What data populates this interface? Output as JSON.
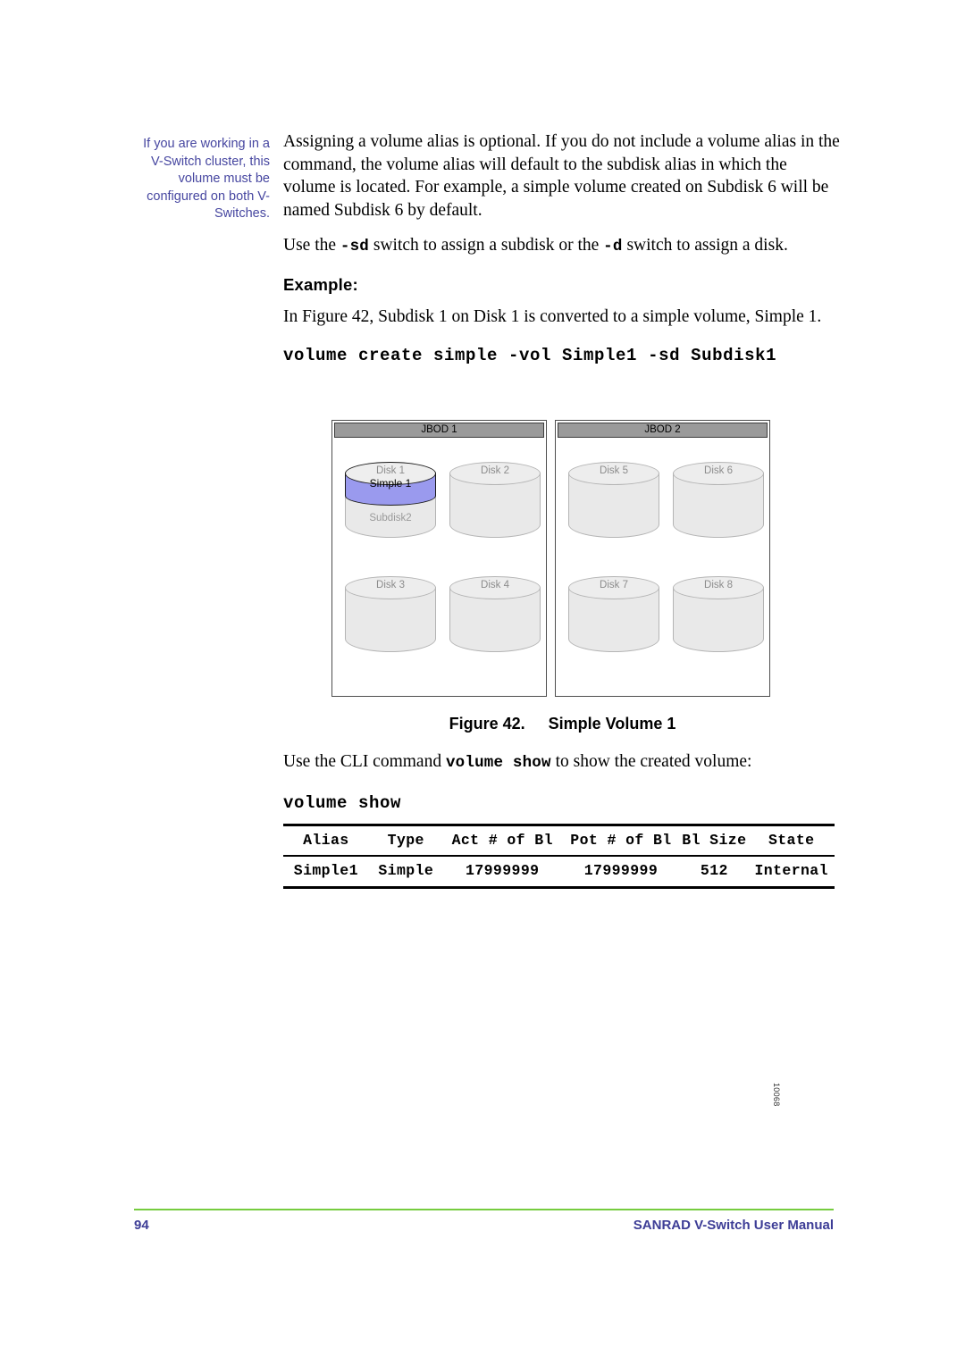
{
  "margin_note": {
    "text": "If you are working in a V-Switch cluster, this volume must be configured on both V-Switches.",
    "color": "#4646a0"
  },
  "body": {
    "paragraph_1": "Assigning a volume alias is optional.  If you do not include a volume alias in the command, the volume alias will default to the subdisk alias in which the volume is located.  For example, a simple volume created on Subdisk 6 will be named Subdisk 6 by default.",
    "paragraph_2_before": "Use the ",
    "paragraph_2_code_1": "-sd",
    "paragraph_2_mid": " switch to assign a subdisk or the ",
    "paragraph_2_code_2": "-d",
    "paragraph_2_after": " switch to assign a disk.",
    "example_heading": "Example:",
    "example_intro": "In Figure 42, Subdisk 1 on Disk 1 is converted to a simple volume, Simple 1.",
    "command_create": "volume create simple -vol Simple1 -sd Subdisk1",
    "cli_line_before": "Use the CLI command ",
    "cli_line_code": "volume show",
    "cli_line_after": " to show the created volume:",
    "command_show": "volume show"
  },
  "figure": {
    "caption_number": "Figure 42.",
    "caption_title": "Simple Volume 1",
    "figure_id": "10068",
    "enclosures": [
      {
        "title": "JBOD 1",
        "disks": [
          {
            "label": "Disk 1",
            "highlighted": true,
            "band_label": "Simple 1",
            "sub_label": "Subdisk2",
            "band_color": "#9a9aee"
          },
          {
            "label": "Disk 2",
            "highlighted": false
          },
          {
            "label": "Disk 3",
            "highlighted": false
          },
          {
            "label": "Disk 4",
            "highlighted": false
          }
        ]
      },
      {
        "title": "JBOD 2",
        "disks": [
          {
            "label": "Disk 5",
            "highlighted": false
          },
          {
            "label": "Disk 6",
            "highlighted": false
          },
          {
            "label": "Disk 7",
            "highlighted": false
          },
          {
            "label": "Disk 8",
            "highlighted": false
          }
        ]
      }
    ]
  },
  "table": {
    "headers": [
      "Alias",
      "Type",
      "Act # of Bl",
      "Pot # of Bl",
      "Bl Size",
      "State"
    ],
    "rows": [
      [
        "Simple1",
        "Simple",
        "17999999",
        "17999999",
        "512",
        "Internal"
      ]
    ]
  },
  "footer": {
    "page_number": "94",
    "title": "SANRAD V-Switch  User Manual",
    "rule_color": "#76cc3f",
    "text_color": "#3d3d96"
  }
}
